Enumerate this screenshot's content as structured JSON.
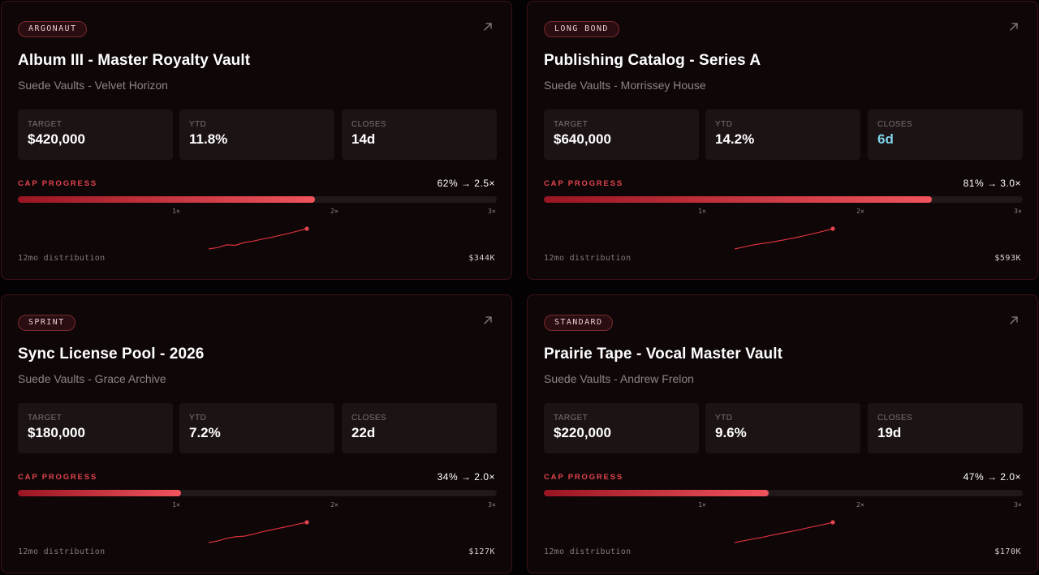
{
  "accent_color": "#e2444e",
  "closes_highlight_color": "#7fd3ea",
  "cards": [
    {
      "badge": "ARGONAUT",
      "title": "Album III - Master Royalty Vault",
      "subtitle": "Suede Vaults - Velvet Horizon",
      "stats": [
        {
          "label": "TARGET",
          "value": "$420,000"
        },
        {
          "label": "YTD",
          "value": "11.8%"
        },
        {
          "label": "CLOSES",
          "value": "14d"
        }
      ],
      "progress_label": "CAP PROGRESS",
      "progress_text": "62% → 2.5×",
      "progress_fraction": 0.62,
      "ticks": [
        "1×",
        "2×",
        "3×"
      ],
      "footer_label": "12mo distribution",
      "footer_value": "$344K",
      "closes_highlight": false,
      "sparkline": [
        2,
        2.6,
        3.8,
        3.6,
        4.8,
        5.4,
        6.3,
        7.0,
        7.9,
        8.8,
        9.8,
        10.8
      ]
    },
    {
      "badge": "LONG BOND",
      "title": "Publishing Catalog - Series A",
      "subtitle": "Suede Vaults - Morrissey House",
      "stats": [
        {
          "label": "TARGET",
          "value": "$640,000"
        },
        {
          "label": "YTD",
          "value": "14.2%"
        },
        {
          "label": "CLOSES",
          "value": "6d"
        }
      ],
      "progress_label": "CAP PROGRESS",
      "progress_text": "81% → 3.0×",
      "progress_fraction": 0.81,
      "ticks": [
        "1×",
        "2×",
        "3×"
      ],
      "footer_label": "12mo distribution",
      "footer_value": "$593K",
      "closes_highlight": true,
      "sparkline": [
        2,
        2.9,
        3.8,
        4.5,
        5.1,
        5.8,
        6.6,
        7.4,
        8.3,
        9.3,
        10.3,
        11.4
      ]
    },
    {
      "badge": "SPRINT",
      "title": "Sync License Pool - 2026",
      "subtitle": "Suede Vaults - Grace Archive",
      "stats": [
        {
          "label": "TARGET",
          "value": "$180,000"
        },
        {
          "label": "YTD",
          "value": "7.2%"
        },
        {
          "label": "CLOSES",
          "value": "22d"
        }
      ],
      "progress_label": "CAP PROGRESS",
      "progress_text": "34% → 2.0×",
      "progress_fraction": 0.34,
      "ticks": [
        "1×",
        "2×",
        "3×"
      ],
      "footer_label": "12mo distribution",
      "footer_value": "$127K",
      "closes_highlight": false,
      "sparkline": [
        2,
        2.7,
        3.9,
        4.6,
        4.9,
        5.8,
        6.9,
        7.7,
        8.6,
        9.4,
        10.4,
        11.2
      ]
    },
    {
      "badge": "STANDARD",
      "title": "Prairie Tape - Vocal Master Vault",
      "subtitle": "Suede Vaults - Andrew Frelon",
      "stats": [
        {
          "label": "TARGET",
          "value": "$220,000"
        },
        {
          "label": "YTD",
          "value": "9.6%"
        },
        {
          "label": "CLOSES",
          "value": "19d"
        }
      ],
      "progress_label": "CAP PROGRESS",
      "progress_text": "47% → 2.0×",
      "progress_fraction": 0.47,
      "ticks": [
        "1×",
        "2×",
        "3×"
      ],
      "footer_label": "12mo distribution",
      "footer_value": "$170K",
      "closes_highlight": false,
      "sparkline": [
        2,
        2.8,
        3.6,
        4.3,
        5.2,
        6.0,
        6.8,
        7.6,
        8.5,
        9.4,
        10.2,
        11.2
      ]
    }
  ]
}
